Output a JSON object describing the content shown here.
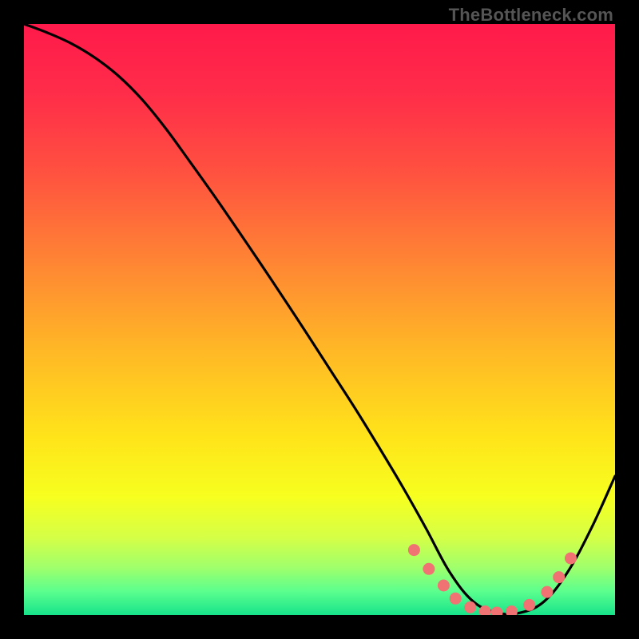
{
  "watermark": "TheBottleneck.com",
  "chart_data": {
    "type": "line",
    "title": "",
    "xlabel": "",
    "ylabel": "",
    "xlim": [
      0,
      100
    ],
    "ylim": [
      0,
      100
    ],
    "series": [
      {
        "name": "curve",
        "x": [
          0,
          4,
          8,
          12,
          16,
          20,
          24,
          28,
          32,
          36,
          40,
          44,
          48,
          52,
          56,
          60,
          64,
          68,
          72,
          76,
          80,
          84,
          88,
          92,
          96,
          100
        ],
        "y": [
          100,
          98.5,
          96.7,
          94.3,
          91.2,
          87.2,
          82.3,
          76.8,
          71.2,
          65.4,
          59.5,
          53.5,
          47.4,
          41.2,
          35.0,
          28.5,
          21.8,
          14.7,
          7.3,
          2.3,
          0.4,
          0.4,
          2.3,
          7.3,
          14.7,
          23.5
        ]
      }
    ],
    "markers": {
      "name": "dots",
      "color": "#f07272",
      "x": [
        66.0,
        68.5,
        71.0,
        73.0,
        75.5,
        78.0,
        80.0,
        82.5,
        85.5,
        88.5,
        90.5,
        92.5
      ],
      "y": [
        11.0,
        7.8,
        5.0,
        2.8,
        1.3,
        0.6,
        0.4,
        0.6,
        1.7,
        3.9,
        6.4,
        9.6
      ]
    },
    "gradient_stops": [
      {
        "offset": 0.0,
        "color": "#ff1a4b"
      },
      {
        "offset": 0.12,
        "color": "#ff2d49"
      },
      {
        "offset": 0.25,
        "color": "#ff5140"
      },
      {
        "offset": 0.4,
        "color": "#ff8434"
      },
      {
        "offset": 0.55,
        "color": "#ffb726"
      },
      {
        "offset": 0.7,
        "color": "#ffe41a"
      },
      {
        "offset": 0.8,
        "color": "#f7ff1f"
      },
      {
        "offset": 0.87,
        "color": "#d4ff47"
      },
      {
        "offset": 0.92,
        "color": "#9fff6c"
      },
      {
        "offset": 0.96,
        "color": "#5bff8e"
      },
      {
        "offset": 1.0,
        "color": "#17e38a"
      }
    ]
  }
}
